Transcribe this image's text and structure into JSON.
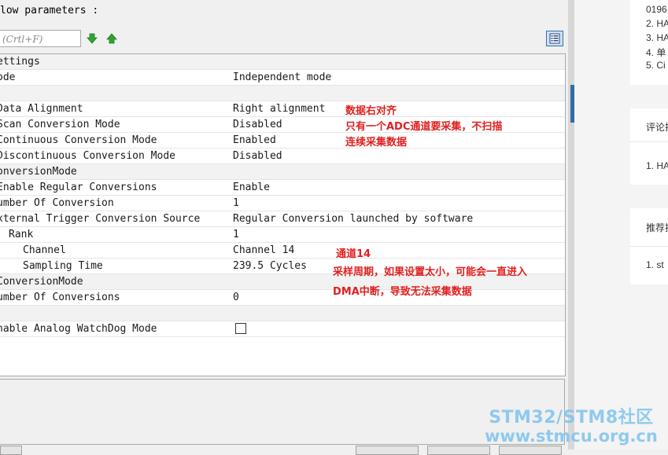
{
  "dialog": {
    "section_title": "low parameters :",
    "search_placeholder": "(Crtl+F)",
    "grid_rows": [
      {
        "name": "ettings",
        "value": ""
      },
      {
        "name": "ode",
        "value": "Independent mode"
      },
      {
        "name": "",
        "value": ""
      },
      {
        "name": "Data Alignment",
        "value": "Right alignment"
      },
      {
        "name": "Scan Conversion Mode",
        "value": "Disabled"
      },
      {
        "name": "Continuous Conversion Mode",
        "value": "Enabled"
      },
      {
        "name": "Discontinuous Conversion Mode",
        "value": "Disabled"
      },
      {
        "name": "onversionMode",
        "value": ""
      },
      {
        "name": "Enable Regular Conversions",
        "value": "Enable"
      },
      {
        "name": "umber Of Conversion",
        "value": "1"
      },
      {
        "name": "xternal Trigger Conversion Source",
        "value": "Regular Conversion launched by software"
      },
      {
        "name": "Rank",
        "value": "1"
      },
      {
        "name": "Channel",
        "value": "Channel 14"
      },
      {
        "name": "Sampling Time",
        "value": "239.5 Cycles"
      },
      {
        "name": "ConversionMode",
        "value": ""
      },
      {
        "name": "umber Of Conversions",
        "value": "0"
      },
      {
        "name": "",
        "value": ""
      },
      {
        "name": "nable Analog WatchDog Mode",
        "value": ""
      }
    ],
    "watchdog_checked": false
  },
  "annotations": {
    "data_align": "数据右对齐",
    "scan_mode": "只有一个ADC通道要采集，不扫描",
    "continuous": "连续采集数据",
    "channel": "通道14",
    "sampling_1": "采样周期，如果设置太小，可能会一直进入",
    "sampling_2": "DMA中断，导致无法采集数据",
    "color": "#e02020"
  },
  "sidebar": {
    "list1": [
      "0196",
      "2. HA",
      "3. HA",
      "4. 单",
      "5. Ci"
    ],
    "comment_header": "评论排",
    "comment_item": "1. HA",
    "recommend_header": "推荐排",
    "recommend_item": "1. st"
  },
  "watermark": {
    "line1": "STM32/STM8社区",
    "line2": "www.stmcu.org.cn",
    "color": "#7ec3ee"
  },
  "icons": {
    "down": "green-down-arrow-icon",
    "up": "green-up-arrow-icon",
    "list_view": "list-view-icon"
  }
}
